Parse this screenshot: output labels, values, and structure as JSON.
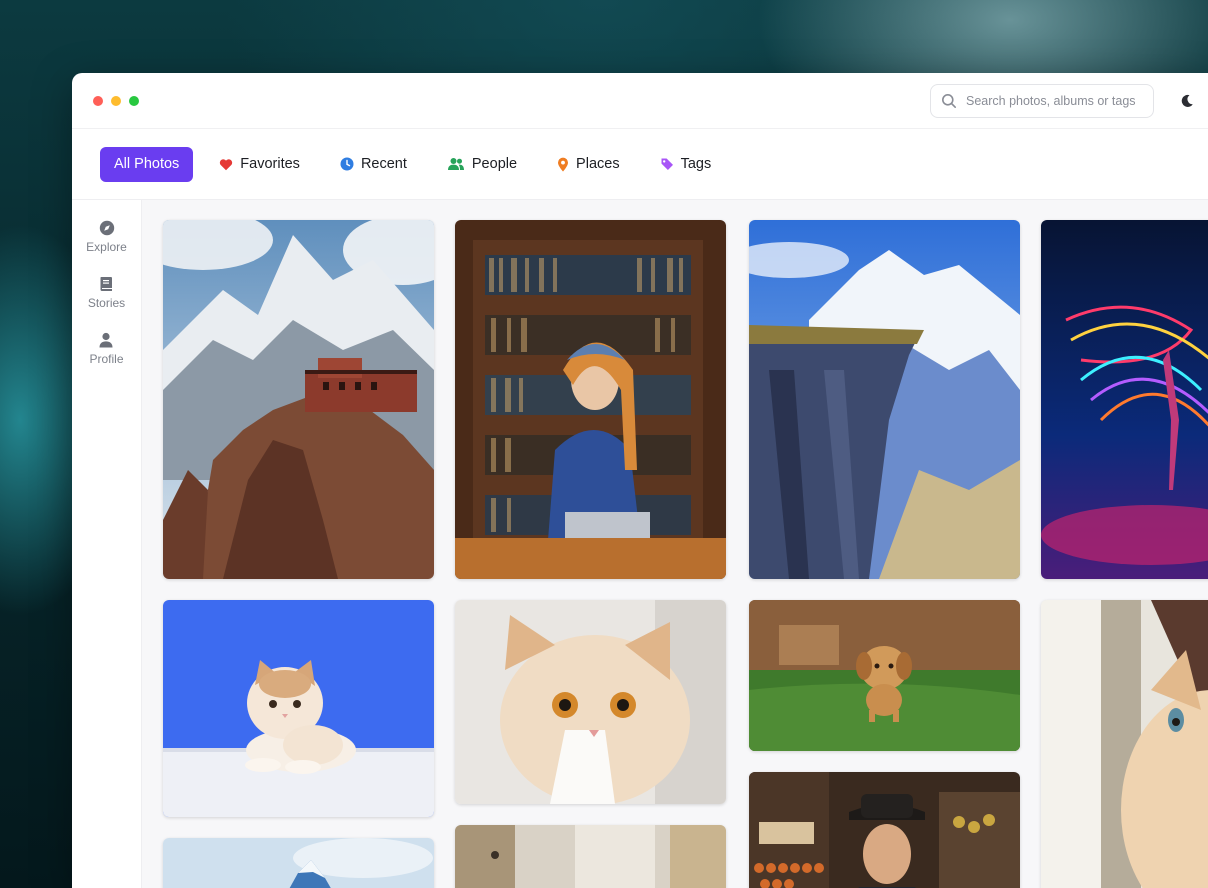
{
  "search": {
    "placeholder": "Search photos, albums or tags"
  },
  "tabs": [
    {
      "label": "All Photos",
      "icon": "grid",
      "active": true
    },
    {
      "label": "Favorites",
      "icon": "heart-icon",
      "color": "#e53935"
    },
    {
      "label": "Recent",
      "icon": "clock-icon",
      "color": "#2f7de1"
    },
    {
      "label": "People",
      "icon": "people-icon",
      "color": "#27a35a"
    },
    {
      "label": "Places",
      "icon": "pin-icon",
      "color": "#ef7d22"
    },
    {
      "label": "Tags",
      "icon": "tag-icon",
      "color": "#a855f7"
    }
  ],
  "sidebar": {
    "items": [
      {
        "label": "Explore",
        "icon": "compass-icon"
      },
      {
        "label": "Stories",
        "icon": "book-icon"
      },
      {
        "label": "Profile",
        "icon": "user-icon"
      }
    ]
  },
  "colors": {
    "accent": "#6a3df0"
  },
  "photos": [
    {
      "subject": "mountain-monastery-photo"
    },
    {
      "subject": "woman-in-library-photo"
    },
    {
      "subject": "mountain-cliff-photo"
    },
    {
      "subject": "light-dancer-photo"
    },
    {
      "subject": "cat-blue-background-photo"
    },
    {
      "subject": "cat-closeup-photo"
    },
    {
      "subject": "running-puppy-photo"
    },
    {
      "subject": "cat-profile-photo"
    },
    {
      "subject": "snow-peak-photo"
    },
    {
      "subject": "room-interior-photo"
    },
    {
      "subject": "man-in-hat-photo"
    }
  ]
}
